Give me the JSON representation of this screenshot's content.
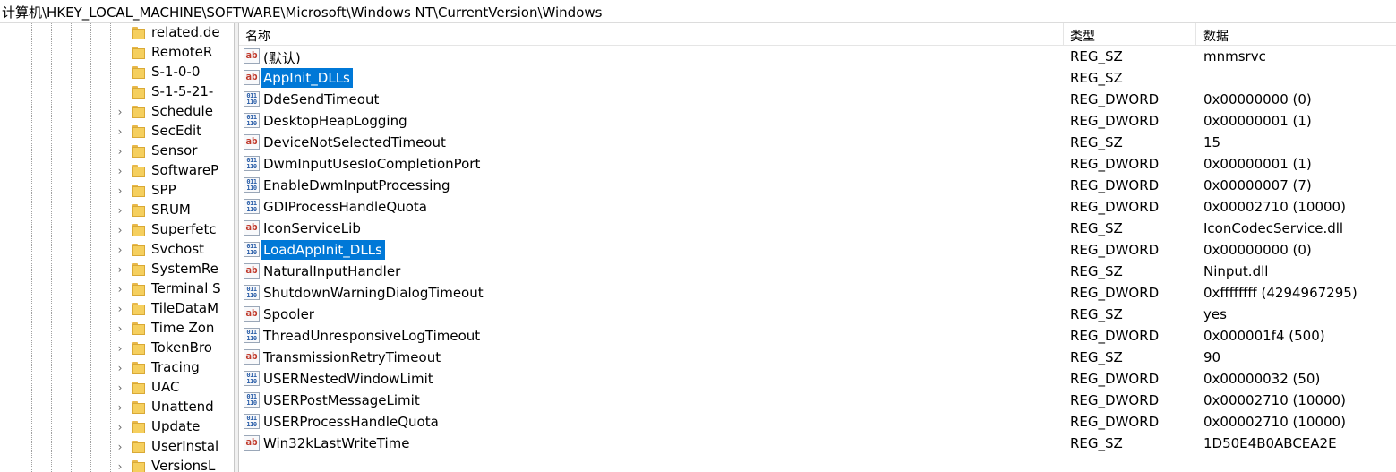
{
  "address": {
    "path": "计算机\\HKEY_LOCAL_MACHINE\\SOFTWARE\\Microsoft\\Windows NT\\CurrentVersion\\Windows"
  },
  "tree": {
    "items": [
      {
        "label": "related.de",
        "expandable": false
      },
      {
        "label": "RemoteR",
        "expandable": false
      },
      {
        "label": "S-1-0-0",
        "expandable": false
      },
      {
        "label": "S-1-5-21-",
        "expandable": false
      },
      {
        "label": "Schedule",
        "expandable": true
      },
      {
        "label": "SecEdit",
        "expandable": true
      },
      {
        "label": "Sensor",
        "expandable": true
      },
      {
        "label": "SoftwareP",
        "expandable": true
      },
      {
        "label": "SPP",
        "expandable": true
      },
      {
        "label": "SRUM",
        "expandable": true
      },
      {
        "label": "Superfetc",
        "expandable": true
      },
      {
        "label": "Svchost",
        "expandable": true
      },
      {
        "label": "SystemRe",
        "expandable": true
      },
      {
        "label": "Terminal S",
        "expandable": true
      },
      {
        "label": "TileDataM",
        "expandable": true
      },
      {
        "label": "Time Zon",
        "expandable": true
      },
      {
        "label": "TokenBro",
        "expandable": true
      },
      {
        "label": "Tracing",
        "expandable": true
      },
      {
        "label": "UAC",
        "expandable": true
      },
      {
        "label": "Unattend",
        "expandable": true
      },
      {
        "label": "Update",
        "expandable": true
      },
      {
        "label": "UserInstal",
        "expandable": true
      },
      {
        "label": "VersionsL",
        "expandable": true
      }
    ]
  },
  "list": {
    "columns": {
      "name": "名称",
      "type": "类型",
      "data": "数据"
    },
    "icons": {
      "sz": "ab",
      "dword": "011 110"
    },
    "rows": [
      {
        "name": "(默认)",
        "type": "REG_SZ",
        "data": "mnmsrvc",
        "icon": "sz",
        "selected": false
      },
      {
        "name": "AppInit_DLLs",
        "type": "REG_SZ",
        "data": "",
        "icon": "sz",
        "selected": true
      },
      {
        "name": "DdeSendTimeout",
        "type": "REG_DWORD",
        "data": "0x00000000 (0)",
        "icon": "dword",
        "selected": false
      },
      {
        "name": "DesktopHeapLogging",
        "type": "REG_DWORD",
        "data": "0x00000001 (1)",
        "icon": "dword",
        "selected": false
      },
      {
        "name": "DeviceNotSelectedTimeout",
        "type": "REG_SZ",
        "data": "15",
        "icon": "sz",
        "selected": false
      },
      {
        "name": "DwmInputUsesIoCompletionPort",
        "type": "REG_DWORD",
        "data": "0x00000001 (1)",
        "icon": "dword",
        "selected": false
      },
      {
        "name": "EnableDwmInputProcessing",
        "type": "REG_DWORD",
        "data": "0x00000007 (7)",
        "icon": "dword",
        "selected": false
      },
      {
        "name": "GDIProcessHandleQuota",
        "type": "REG_DWORD",
        "data": "0x00002710 (10000)",
        "icon": "dword",
        "selected": false
      },
      {
        "name": "IconServiceLib",
        "type": "REG_SZ",
        "data": "IconCodecService.dll",
        "icon": "sz",
        "selected": false
      },
      {
        "name": "LoadAppInit_DLLs",
        "type": "REG_DWORD",
        "data": "0x00000000 (0)",
        "icon": "dword",
        "selected": true
      },
      {
        "name": "NaturalInputHandler",
        "type": "REG_SZ",
        "data": "Ninput.dll",
        "icon": "sz",
        "selected": false
      },
      {
        "name": "ShutdownWarningDialogTimeout",
        "type": "REG_DWORD",
        "data": "0xffffffff (4294967295)",
        "icon": "dword",
        "selected": false
      },
      {
        "name": "Spooler",
        "type": "REG_SZ",
        "data": "yes",
        "icon": "sz",
        "selected": false
      },
      {
        "name": "ThreadUnresponsiveLogTimeout",
        "type": "REG_DWORD",
        "data": "0x000001f4 (500)",
        "icon": "dword",
        "selected": false
      },
      {
        "name": "TransmissionRetryTimeout",
        "type": "REG_SZ",
        "data": "90",
        "icon": "sz",
        "selected": false
      },
      {
        "name": "USERNestedWindowLimit",
        "type": "REG_DWORD",
        "data": "0x00000032 (50)",
        "icon": "dword",
        "selected": false
      },
      {
        "name": "USERPostMessageLimit",
        "type": "REG_DWORD",
        "data": "0x00002710 (10000)",
        "icon": "dword",
        "selected": false
      },
      {
        "name": "USERProcessHandleQuota",
        "type": "REG_DWORD",
        "data": "0x00002710 (10000)",
        "icon": "dword",
        "selected": false
      },
      {
        "name": "Win32kLastWriteTime",
        "type": "REG_SZ",
        "data": "1D50E4B0ABCEA2E",
        "icon": "sz",
        "selected": false
      }
    ]
  },
  "colors": {
    "selection": "#0078d7",
    "folder": "#f5cf5e"
  }
}
